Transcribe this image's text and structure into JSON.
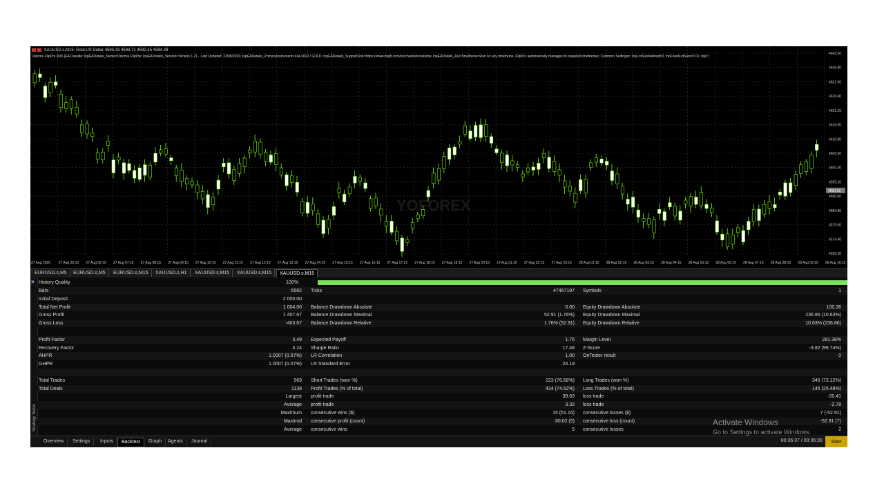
{
  "chart": {
    "title": "XAUUSD.s,M15: Gold US Dollar 4594.33 4594.71 4592.45 4594.39",
    "description": "Osloma FlipPro M15 [EA Datalite: InpEADetails_Name=Osloma FlipPro; InpEADetails_Version=Version 1.21 - Last Updated: 23/08/2026; InpEADetails_PrimaryInstrument=XAUUSD / GOLD; InpEADetails_SupportLink=https://www.mql5.com/en/channels/osloma; InpEADetails_RunTimeframe=Run on any timeframe, FlipPro automatically manages its required timeframes; Common Settings=; InpLotSizeMethod=0; InpFixedLotSize=0.01; InpTr",
    "price_labels": [
      "4642.00",
      "4636.80",
      "4631.60",
      "4626.40",
      "4621.20",
      "4616.00",
      "4610.80",
      "4605.60",
      "4600.40",
      "4595.20",
      "4590.00",
      "4584.80",
      "4579.60",
      "4574.40",
      "4569.20"
    ],
    "current_price": "4594.39",
    "time_labels": [
      "27 Aug 2026",
      "27 Aug 05:15",
      "27 Aug 06:15",
      "27 Aug 07:15",
      "27 Aug 08:15",
      "27 Aug 09:15",
      "27 Aug 10:15",
      "27 Aug 11:15",
      "27 Aug 12:15",
      "27 Aug 13:15",
      "27 Aug 14:15",
      "27 Aug 15:15",
      "27 Aug 16:15",
      "27 Aug 17:15",
      "27 Aug 18:15",
      "27 Aug 19:15",
      "27 Aug 20:15",
      "27 Aug 21:15",
      "27 Aug 22:15",
      "27 Aug 23:15",
      "28 Aug 01:15",
      "28 Aug 02:15",
      "28 Aug 03:15",
      "28 Aug 04:15",
      "28 Aug 05:15",
      "28 Aug 06:15",
      "28 Aug 07:15",
      "28 Aug 08:15",
      "28 Aug 09:15",
      "28 Aug 10:15"
    ],
    "watermark": "YOFOREX",
    "colors": {
      "bull": "#ffffff",
      "bear": "#000000",
      "wick": "#7CFC00",
      "grid": "#3a3a3a"
    }
  },
  "chart_tabs": [
    "EURUSD.s,M5",
    "EURUSD.s,M5",
    "EURUSD.s,M15",
    "XAUUSD.s,H1",
    "XAUUSD.s,M15",
    "XAUUSD.s,M15",
    "XAUUSD.s,M15"
  ],
  "report": {
    "history_quality": {
      "label": "History Quality",
      "value": "100%"
    },
    "rows": [
      [
        [
          "Bars",
          "6582"
        ],
        [
          "Ticks",
          "47467197"
        ],
        [
          "Symbols",
          "1"
        ]
      ],
      [
        [
          "Initial Deposit",
          "2 000.00"
        ],
        [
          "",
          ""
        ],
        [
          "",
          ""
        ]
      ],
      [
        [
          "Total Net Profit",
          "1 004.00"
        ],
        [
          "Balance Drawdown Absolute",
          "0.00"
        ],
        [
          "Equity Drawdown Absolute",
          "100.36"
        ]
      ],
      [
        [
          "Gross Profit",
          "1 407.67"
        ],
        [
          "Balance Drawdown Maximal",
          "52.91 (1.76%)"
        ],
        [
          "Equity Drawdown Maximal",
          "236.86 (10.63%)"
        ]
      ],
      [
        [
          "Gross Loss",
          "-403.67"
        ],
        [
          "Balance Drawdown Relative",
          "1.76% (52.91)"
        ],
        [
          "Equity Drawdown Relative",
          "10.63% (236.86)"
        ]
      ],
      [
        [
          "",
          ""
        ],
        [
          "",
          ""
        ],
        [
          "",
          ""
        ]
      ],
      [
        [
          "Profit Factor",
          "3.49"
        ],
        [
          "Expected Payoff",
          "1.76"
        ],
        [
          "Margin Level",
          "281.38%"
        ]
      ],
      [
        [
          "Recovery Factor",
          "4.24"
        ],
        [
          "Sharpe Ratio",
          "17.48"
        ],
        [
          "Z-Score",
          "-3.82 (99.74%)"
        ]
      ],
      [
        [
          "AHPR",
          "1.0007 (0.07%)"
        ],
        [
          "LR Correlation",
          "1.00"
        ],
        [
          "OnTester result",
          "0"
        ]
      ],
      [
        [
          "GHPR",
          "1.0007 (0.07%)"
        ],
        [
          "LR Standard Error",
          "24.19"
        ],
        [
          "",
          ""
        ]
      ],
      [
        [
          "",
          ""
        ],
        [
          "",
          ""
        ],
        [
          "",
          ""
        ]
      ],
      [
        [
          "Total Trades",
          "569"
        ],
        [
          "Short Trades (won %)",
          "223 (76.68%)"
        ],
        [
          "Long Trades (won %)",
          "346 (73.12%)"
        ]
      ],
      [
        [
          "Total Deals",
          "1138"
        ],
        [
          "Profit Trades (% of total)",
          "424 (74.52%)"
        ],
        [
          "Loss Trades (% of total)",
          "145 (25.48%)"
        ]
      ],
      [
        [
          "Largest",
          ""
        ],
        [
          "profit trade",
          "39.63"
        ],
        [
          "loss trade",
          "-20.41"
        ]
      ],
      [
        [
          "Average",
          ""
        ],
        [
          "profit trade",
          "3.32"
        ],
        [
          "loss trade",
          "-2.78"
        ]
      ],
      [
        [
          "Maximum",
          ""
        ],
        [
          "consecutive wins ($)",
          "15 (61.16)"
        ],
        [
          "consecutive losses ($)",
          "7 (-52.91)"
        ]
      ],
      [
        [
          "Maximal",
          ""
        ],
        [
          "consecutive profit (count)",
          "80.02 (5)"
        ],
        [
          "consecutive loss (count)",
          "-52.91 (7)"
        ]
      ],
      [
        [
          "Average",
          ""
        ],
        [
          "consecutive wins",
          "5"
        ],
        [
          "consecutive losses",
          "2"
        ]
      ]
    ],
    "side_label": "Strategy Tester"
  },
  "bottom_tabs": [
    "Overview",
    "Settings",
    "Inputs",
    "Backtest",
    "Graph",
    "Agents",
    "Journal"
  ],
  "active_bottom_tab": "Backtest",
  "timer": "00:36:37 / 00:36:39",
  "start_label": "Start",
  "windows_watermark": {
    "line1": "Activate Windows",
    "line2": "Go to Settings to activate Windows."
  }
}
